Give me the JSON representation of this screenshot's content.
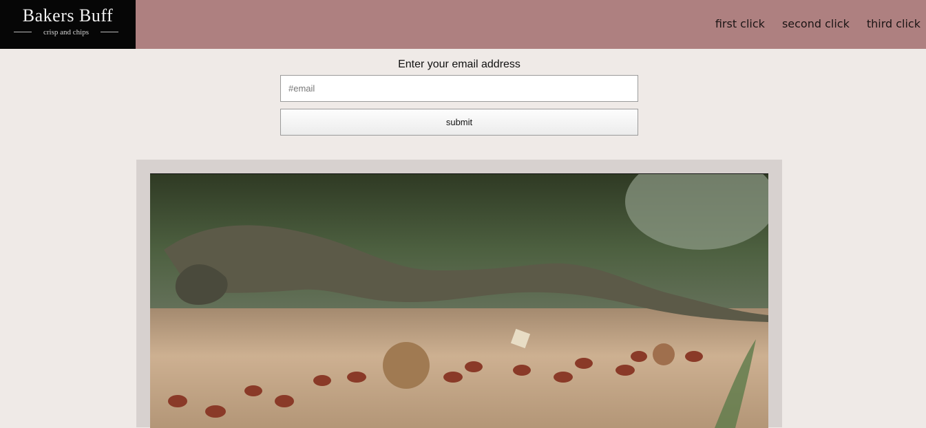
{
  "header": {
    "logo_title": "Bakers Buff",
    "logo_tagline": "crisp and chips",
    "nav": [
      {
        "label": "first click"
      },
      {
        "label": "second click"
      },
      {
        "label": "third click"
      }
    ]
  },
  "form": {
    "label": "Enter your email address",
    "email_placeholder": "#email",
    "submit_label": "submit"
  },
  "colors": {
    "header_bg": "#ae8080",
    "logo_bg": "#060606",
    "page_bg": "#efeae7",
    "video_panel_bg": "#d7d1cf"
  }
}
